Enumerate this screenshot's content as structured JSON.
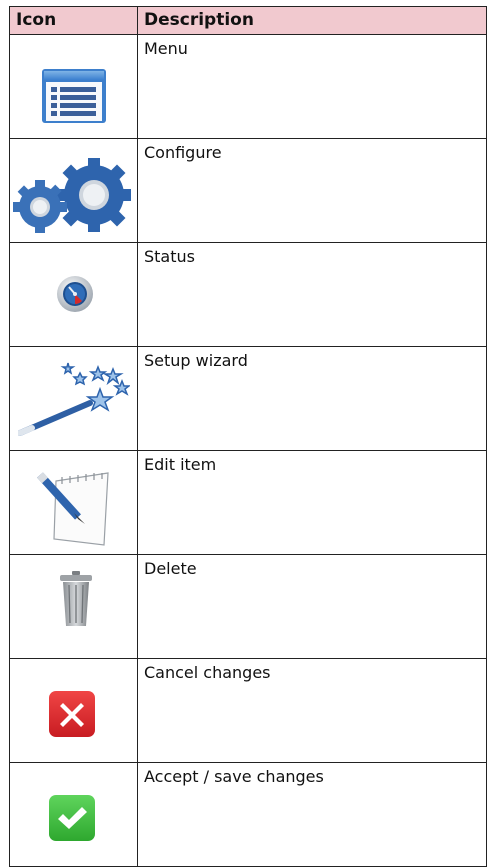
{
  "table": {
    "headers": {
      "icon": "Icon",
      "description": "Description"
    },
    "rows": [
      {
        "icon": "menu-window-icon",
        "description": "Menu"
      },
      {
        "icon": "gears-icon",
        "description": "Configure"
      },
      {
        "icon": "gauge-icon",
        "description": "Status"
      },
      {
        "icon": "magic-wand-icon",
        "description": "Setup wizard"
      },
      {
        "icon": "pencil-notepad-icon",
        "description": "Edit item"
      },
      {
        "icon": "trash-can-icon",
        "description": "Delete"
      },
      {
        "icon": "red-x-icon",
        "description": "Cancel changes"
      },
      {
        "icon": "green-check-icon",
        "description": "Accept / save changes"
      }
    ]
  },
  "colors": {
    "header_bg": "#f1c9cf",
    "cancel_red": "#e0282e",
    "accept_green": "#3dbb3f"
  }
}
